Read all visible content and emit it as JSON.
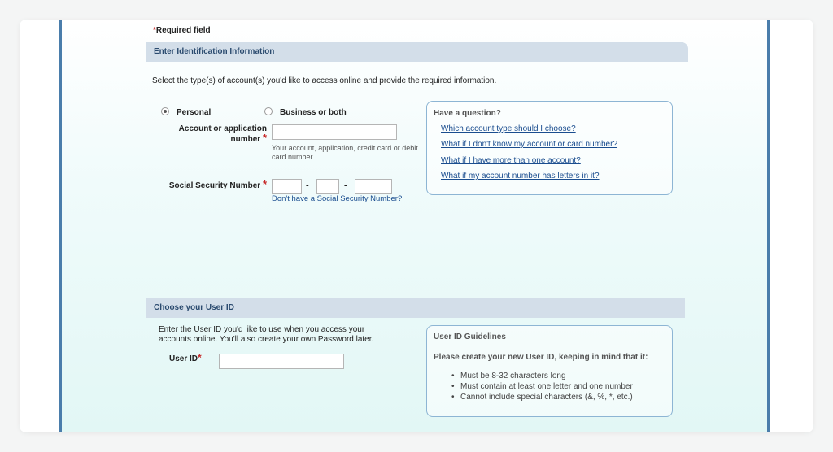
{
  "required_note": {
    "star": "*",
    "text": "Required field"
  },
  "identification": {
    "header": "Enter Identification Information",
    "intro": "Select the type(s) of account(s) you'd like to access online and provide the required information.",
    "account_types": [
      {
        "label": "Personal",
        "selected": true
      },
      {
        "label": "Business or both",
        "selected": false
      }
    ],
    "account_number": {
      "label_line1": "Account or application",
      "label_line2": "number",
      "required_star": "*",
      "value": "",
      "hint": "Your account, application, credit card or debit card number"
    },
    "ssn": {
      "label": "Social Security Number",
      "required_star": "*",
      "part1": "",
      "part2": "",
      "part3": "",
      "separator": "-",
      "no_ssn_link": "Don't have a Social Security Number?"
    },
    "question_box": {
      "title": "Have a question?",
      "links": [
        "Which account type should I choose?",
        "What if I don't know my account or card number?",
        "What if I have more than one account?",
        "What if my account number has letters in it?"
      ]
    }
  },
  "user_id_section": {
    "header": "Choose your User ID",
    "intro_line1": "Enter the User ID you'd like to use when you access your",
    "intro_line2": "accounts online. You'll also create your own Password later.",
    "label": "User ID",
    "required_star": "*",
    "value": "",
    "guidelines": {
      "title": "User ID Guidelines",
      "intro": "Please create your new User ID, keeping in mind that it:",
      "items": [
        "Must be 8-32 characters long",
        "Must contain at least one letter and one number",
        "Cannot include special characters (&, %, *, etc.)"
      ]
    }
  },
  "colors": {
    "frame_border": "#4a7dab",
    "header_bg": "#d3dee9",
    "header_text": "#2b4b6f",
    "required_star": "#c62828",
    "link": "#1a4d8f",
    "box_border": "#8db5d4"
  }
}
